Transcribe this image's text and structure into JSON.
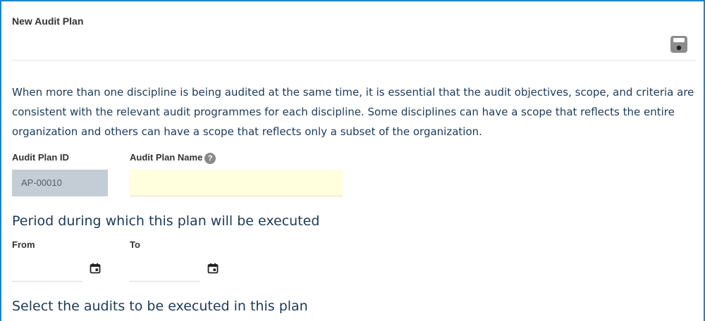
{
  "panel": {
    "title": "New Audit Plan",
    "save_icon": "save-icon"
  },
  "intro_text": "When more than one discipline is being audited at the same time, it is essential that the audit objectives, scope, and criteria are consistent with the relevant audit programmes for each discipline. Some disciplines can have a scope that reflects the entire organization and others can have a scope that reflects only a subset of the organization.",
  "fields": {
    "audit_plan_id_label": "Audit Plan ID",
    "audit_plan_id_value": "AP-00010",
    "audit_plan_name_label": "Audit Plan Name",
    "audit_plan_name_value": "",
    "help_glyph": "?"
  },
  "period": {
    "heading": "Period during which this plan will be executed",
    "from_label": "From",
    "from_value": "",
    "to_label": "To",
    "to_value": ""
  },
  "audits_section": {
    "heading": "Select the audits to be executed in this plan"
  },
  "colors": {
    "frame_border": "#1a85c8",
    "heading_text": "#1b3a5a",
    "readonly_bg": "#c4ccd5",
    "required_bg": "#ffffdd"
  }
}
